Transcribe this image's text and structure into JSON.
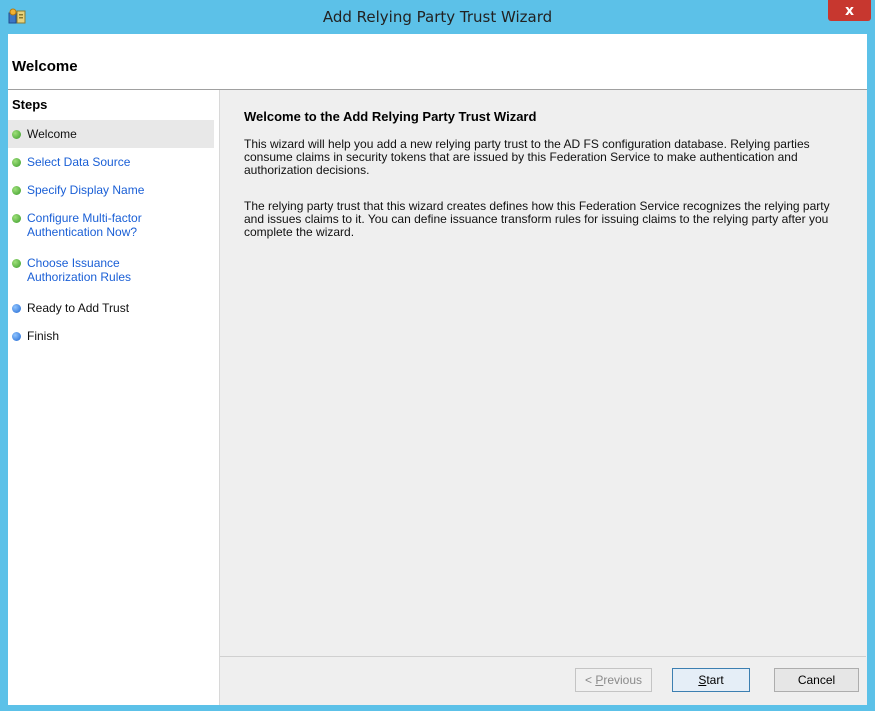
{
  "window": {
    "title": "Add Relying Party Trust Wizard",
    "close_label": "x"
  },
  "header": {
    "title": "Welcome"
  },
  "steps": {
    "title": "Steps",
    "items": [
      {
        "label": "Welcome",
        "state": "current"
      },
      {
        "label": "Select Data Source",
        "state": "upcoming"
      },
      {
        "label": "Specify Display Name",
        "state": "upcoming"
      },
      {
        "label": "Configure Multi-factor Authentication Now?",
        "state": "upcoming"
      },
      {
        "label": "Choose Issuance Authorization Rules",
        "state": "upcoming"
      },
      {
        "label": "Ready to Add Trust",
        "state": "pending"
      },
      {
        "label": "Finish",
        "state": "pending"
      }
    ]
  },
  "content": {
    "title": "Welcome to the Add Relying Party Trust Wizard",
    "paragraph1": "This wizard will help you add a new relying party trust to the AD FS configuration database.  Relying parties consume claims in security tokens that are issued by this Federation Service to make authentication and authorization decisions.",
    "paragraph2": "The relying party trust that this wizard creates defines how this Federation Service recognizes the relying party and issues claims to it. You can define issuance transform rules for issuing claims to the relying party after you complete the wizard."
  },
  "buttons": {
    "previous": {
      "prefix": "< ",
      "mnemonic": "P",
      "rest": "revious",
      "enabled": false
    },
    "start": {
      "mnemonic": "S",
      "rest": "tart"
    },
    "cancel": "Cancel"
  },
  "colors": {
    "titlebar": "#5cc1e8",
    "close": "#c7372f",
    "link": "#1a5fd6",
    "step_done": "#3a9b2a",
    "step_pending": "#1f67d1",
    "content_bg": "#efefef"
  }
}
